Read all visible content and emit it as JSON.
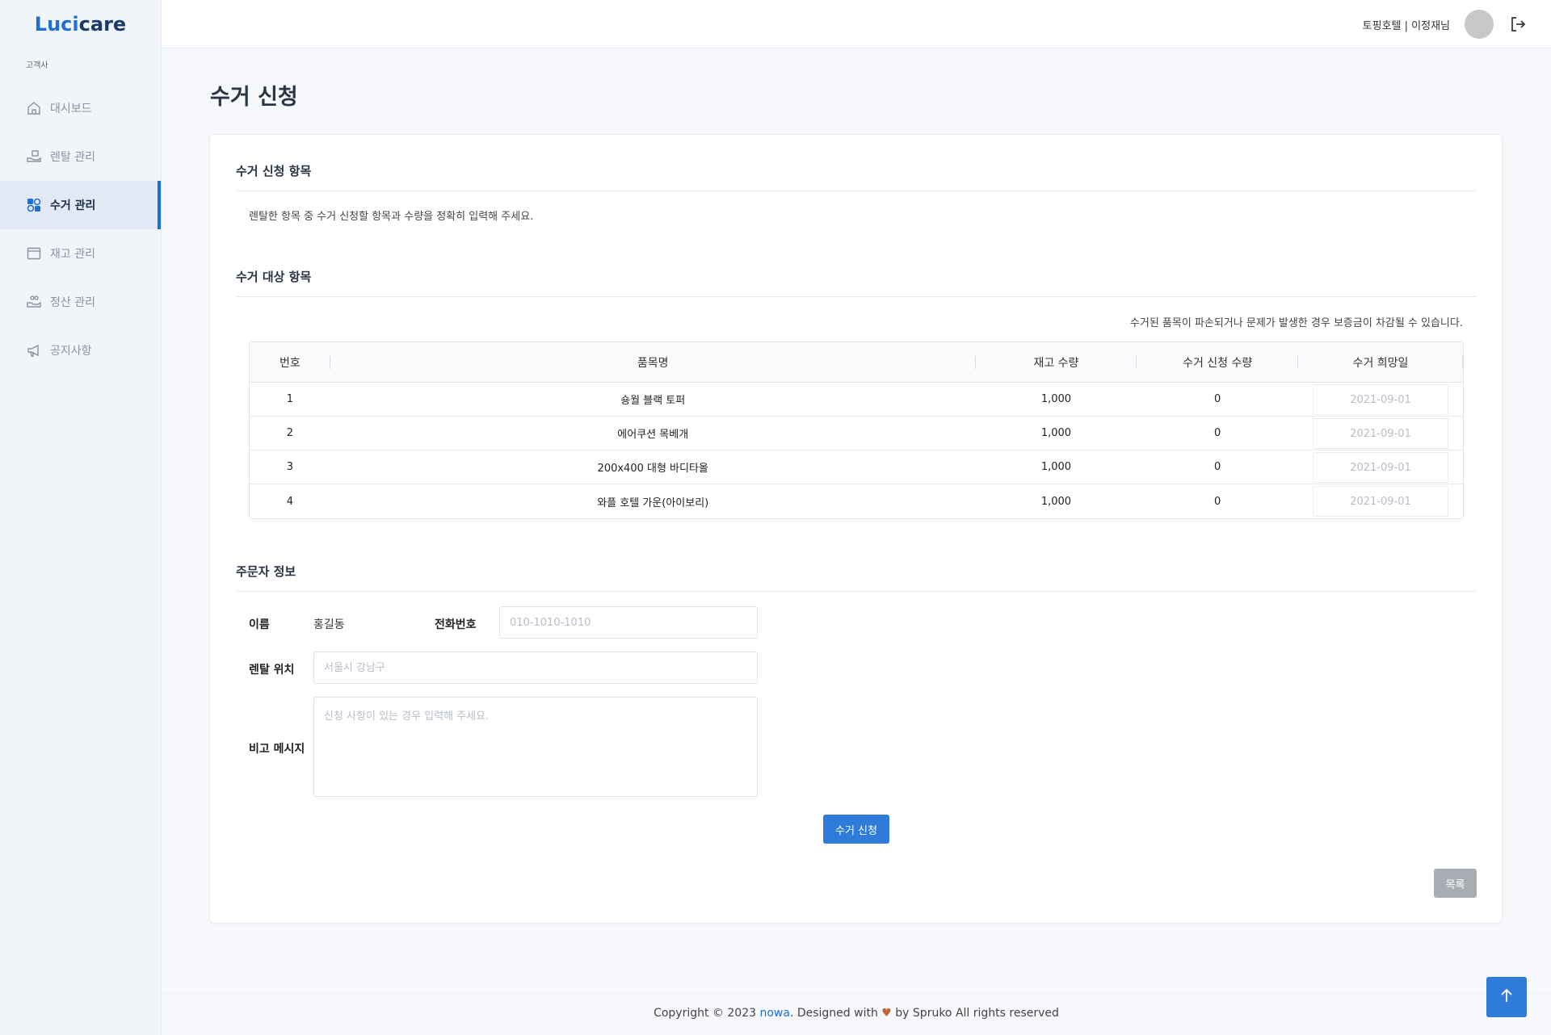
{
  "brand": {
    "part1": "Luci",
    "part2": "care"
  },
  "sidebar": {
    "section": "고객사",
    "items": [
      {
        "label": "대시보드",
        "icon": "home-icon"
      },
      {
        "label": "렌탈 관리",
        "icon": "hand-box-icon"
      },
      {
        "label": "수거 관리",
        "icon": "shapes-icon",
        "active": true
      },
      {
        "label": "재고 관리",
        "icon": "window-icon"
      },
      {
        "label": "정산 관리",
        "icon": "hand-coins-icon"
      },
      {
        "label": "공지사항",
        "icon": "megaphone-icon"
      }
    ]
  },
  "header": {
    "user": "토핑호텔 | 이정재님"
  },
  "page": {
    "title": "수거 신청"
  },
  "section1": {
    "title": "수거 신청 항목",
    "guide": "렌탈한 항목 중 수거 신청할 항목과 수량을 정확히 입력해 주세요."
  },
  "section2": {
    "title": "수거 대상 항목",
    "notice": "수거된 품목이 파손되거나 문제가 발생한 경우 보증금이 차감될 수 있습니다.",
    "columns": [
      "번호",
      "품목명",
      "재고 수량",
      "수거 신청 수량",
      "수거 희망일"
    ],
    "rows": [
      {
        "no": "1",
        "name": "숑월 블랙 토퍼",
        "stock": "1,000",
        "qty": "0",
        "date": "2021-09-01"
      },
      {
        "no": "2",
        "name": "에어쿠션 목베개",
        "stock": "1,000",
        "qty": "0",
        "date": "2021-09-01"
      },
      {
        "no": "3",
        "name": "200x400 대형 바디타올",
        "stock": "1,000",
        "qty": "0",
        "date": "2021-09-01"
      },
      {
        "no": "4",
        "name": "와플 호텔 가운(아이보리)",
        "stock": "1,000",
        "qty": "0",
        "date": "2021-09-01"
      }
    ]
  },
  "section3": {
    "title": "주문자 정보",
    "name_label": "이름",
    "name_value": "홍길동",
    "phone_label": "전화번호",
    "phone_placeholder": "010-1010-1010",
    "location_label": "렌탈 위치",
    "location_placeholder": "서울시 강남구",
    "memo_label": "비고 메시지",
    "memo_placeholder": "신청 사항이 있는 경우 입력해 주세요."
  },
  "actions": {
    "submit": "수거 신청",
    "list": "목록"
  },
  "footer": {
    "prefix": "Copyright © 2023 ",
    "brand": "nowa",
    "middle": ". Designed with ",
    "heart": "♥",
    "suffix": " by Spruko All rights reserved"
  },
  "colors": {
    "accent": "#2f7bd9",
    "brand_dark": "#1b3a6b",
    "muted_button": "#a8adb4"
  }
}
